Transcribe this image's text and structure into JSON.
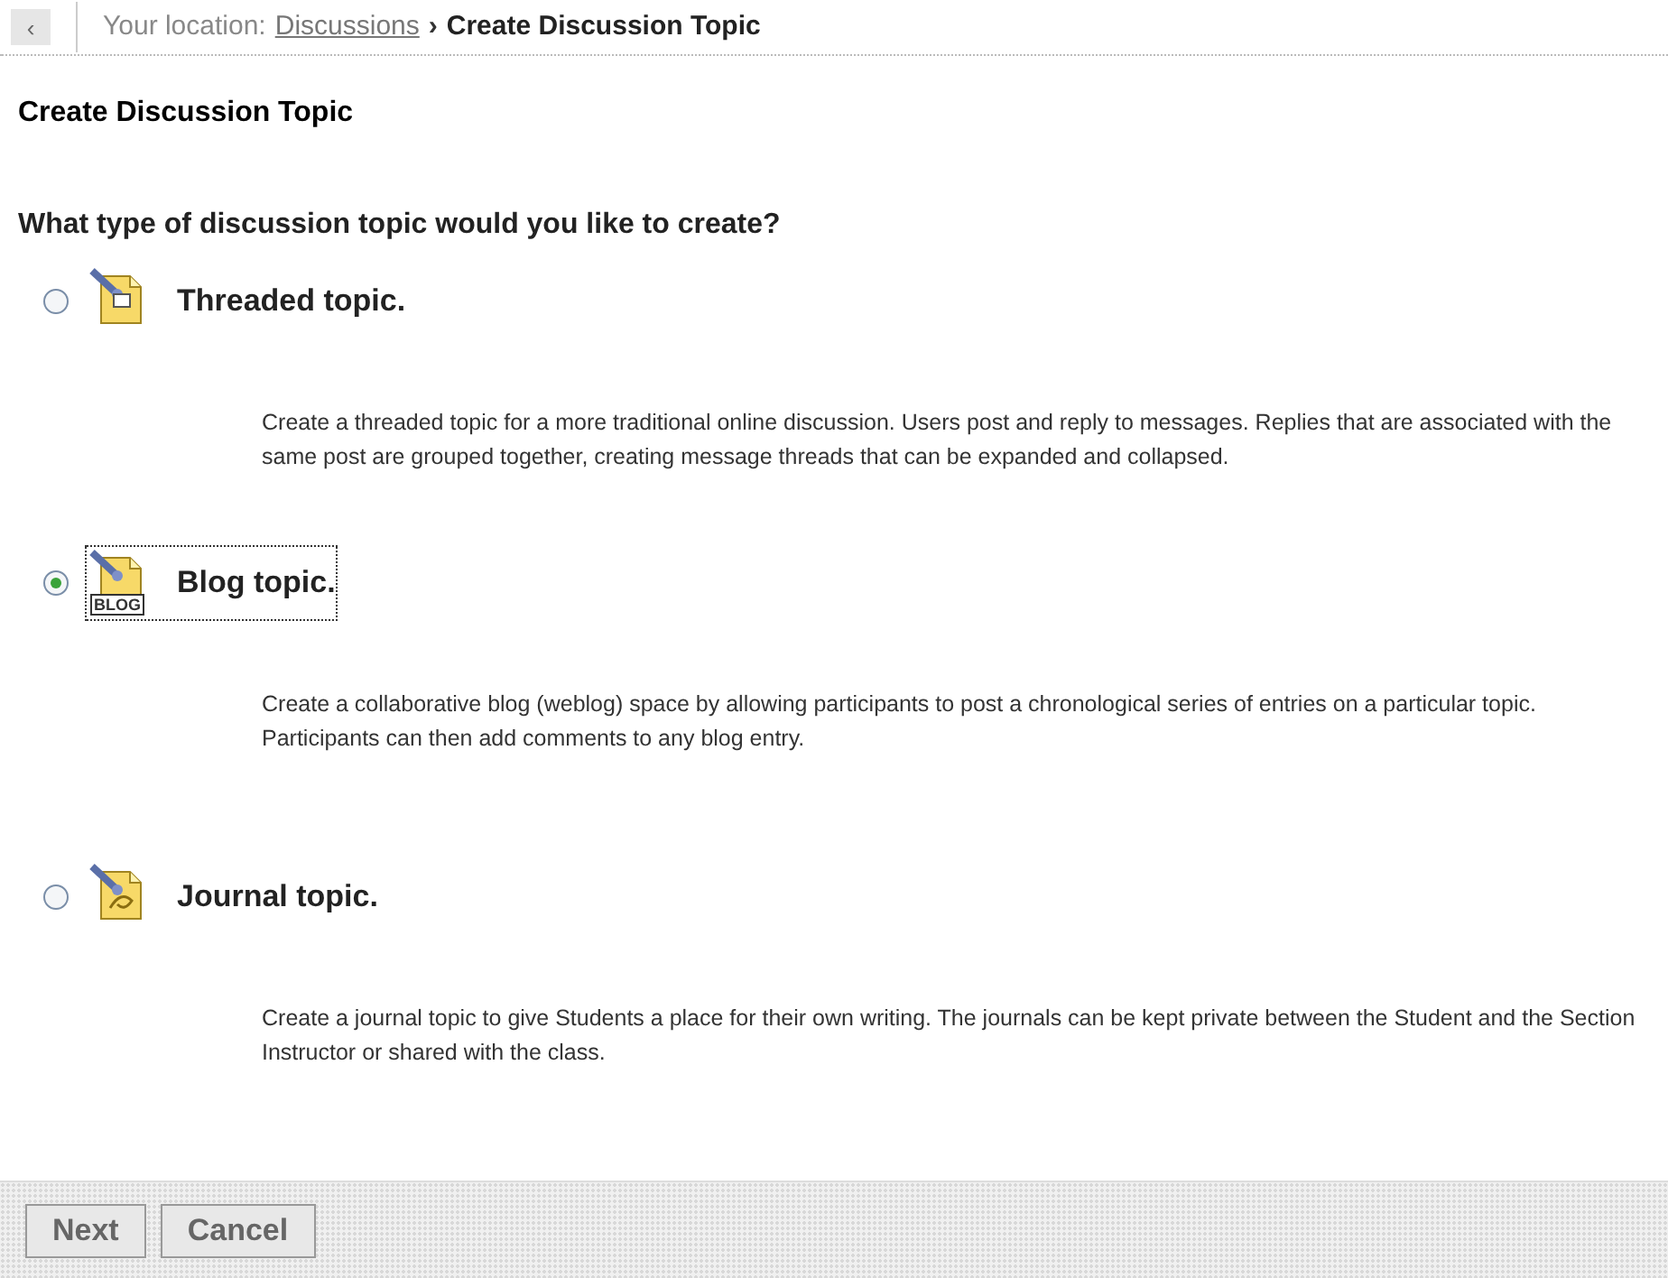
{
  "breadcrumb": {
    "back": "‹",
    "prefix": "Your location:",
    "link": "Discussions",
    "separator": "›",
    "current": "Create Discussion Topic"
  },
  "heading": "Create Discussion Topic",
  "question": "What type of discussion topic would you like to create?",
  "options": [
    {
      "kind": "threaded",
      "label": "Threaded topic.",
      "selected": false,
      "focused": false,
      "description": "Create a threaded topic for a more traditional online discussion. Users post and reply to messages. Replies that are associated with the same post are grouped together, creating message threads that can be expanded and collapsed."
    },
    {
      "kind": "blog",
      "label": "Blog topic.",
      "badge": "BLOG",
      "selected": true,
      "focused": true,
      "description": "Create a collaborative blog (weblog) space by allowing participants to post a chronological series of entries on a particular topic. Participants can then add comments to any blog entry."
    },
    {
      "kind": "journal",
      "label": "Journal topic.",
      "selected": false,
      "focused": false,
      "description": "Create a journal topic to give Students a place for their own writing. The journals can be kept private between the Student and the Section Instructor or shared with the class."
    }
  ],
  "buttons": [
    "Next",
    "Cancel"
  ]
}
